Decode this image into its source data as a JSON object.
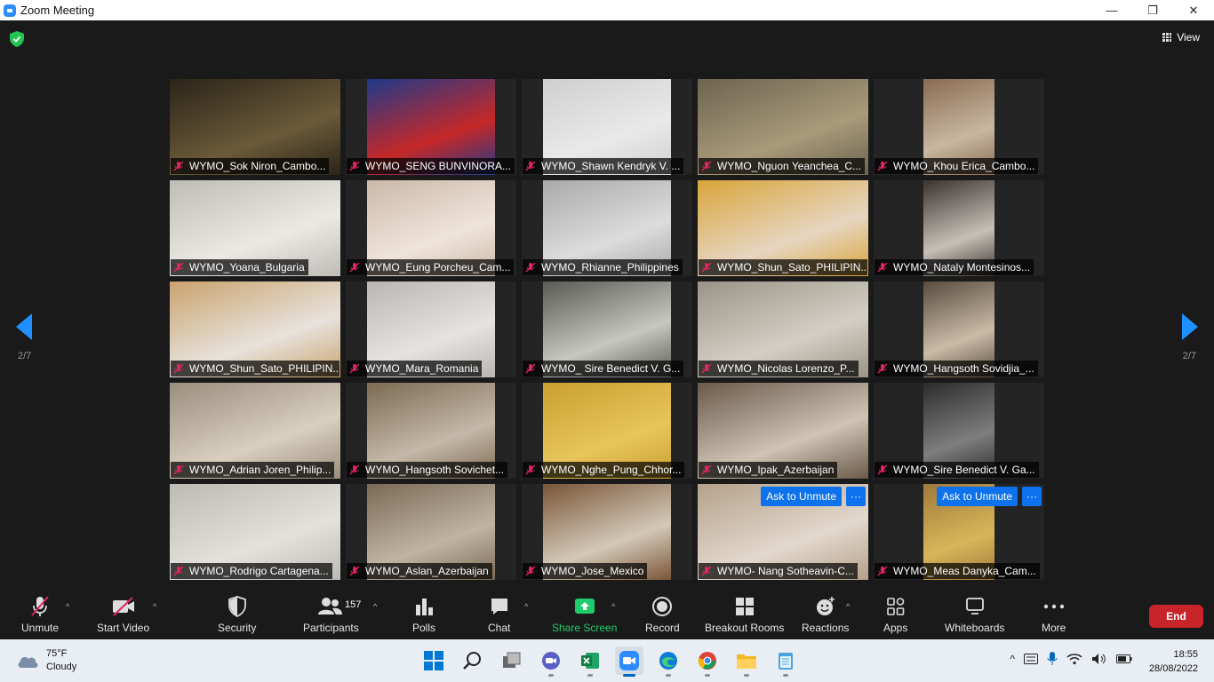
{
  "window": {
    "title": "Zoom Meeting",
    "minimize": "—",
    "restore": "❐",
    "close": "✕"
  },
  "view": {
    "label": "View"
  },
  "pagination": {
    "left": "2/7",
    "right": "2/7"
  },
  "tiles": [
    {
      "name": "WYMO_Sok Niron_Cambo...",
      "bg": "#2b2418",
      "bg2": "#6b5a3a"
    },
    {
      "name": "WYMO_SENG BUNVINORA...",
      "bg": "#1f3a8a",
      "bg2": "#c62828"
    },
    {
      "name": "WYMO_Shawn Kendryk V. ...",
      "bg": "#cfcfcf",
      "bg2": "#e9e9e9"
    },
    {
      "name": "WYMO_Nguon Yeanchea_C...",
      "bg": "#6d6450",
      "bg2": "#a89a7a"
    },
    {
      "name": "WYMO_Khou Erica_Cambo...",
      "bg": "#8a6a52",
      "bg2": "#c8b7a0"
    },
    {
      "name": "WYMO_Yoana_Bulgaria",
      "bg": "#bfbcb7",
      "bg2": "#ece9e4"
    },
    {
      "name": "WYMO_Eung Porcheu_Cam...",
      "bg": "#cbb8a8",
      "bg2": "#efe4da"
    },
    {
      "name": "WYMO_Rhianne_Philippines",
      "bg": "#a9a9a9",
      "bg2": "#dcdcdc"
    },
    {
      "name": "WYMO_Shun_Sato_PHILIPIN...",
      "bg": "#d9a53a",
      "bg2": "#e6d5c0"
    },
    {
      "name": "WYMO_Nataly Montesinos...",
      "bg": "#3b332d",
      "bg2": "#c7c0b9"
    },
    {
      "name": "WYMO_Shun_Sato_PHILIPIN...",
      "bg": "#caa36d",
      "bg2": "#e7e2dc"
    },
    {
      "name": "WYMO_Mara_Romania",
      "bg": "#b9b6b2",
      "bg2": "#e5e3e0"
    },
    {
      "name": "WYMO_ Sire Benedict V. G...",
      "bg": "#5a5a55",
      "bg2": "#c7c7c0"
    },
    {
      "name": "WYMO_Nicolas Lorenzo_P...",
      "bg": "#9a9488",
      "bg2": "#d4cfc4"
    },
    {
      "name": "WYMO_Hangsoth Sovidjia_...",
      "bg": "#5a4c3e",
      "bg2": "#c9bba6"
    },
    {
      "name": "WYMO_Adrian Joren_Philip...",
      "bg": "#9a8e7d",
      "bg2": "#d9cfbf"
    },
    {
      "name": "WYMO_Hangsoth Sovichet...",
      "bg": "#7c6a52",
      "bg2": "#c4b8a8"
    },
    {
      "name": "WYMO_Nghe_Pung_Chhor...",
      "bg": "#c9a030",
      "bg2": "#e8c45a"
    },
    {
      "name": "WYMO_Ipak_Azerbaijan",
      "bg": "#6a5a4a",
      "bg2": "#cfc3b4"
    },
    {
      "name": "WYMO_Sire Benedict V. Ga...",
      "bg": "#2c2c2c",
      "bg2": "#7e7e7e"
    },
    {
      "name": "WYMO_Rodrigo Cartagena...",
      "bg": "#bdbab5",
      "bg2": "#e4e1dc"
    },
    {
      "name": "WYMO_Aslan_Azerbaijan",
      "bg": "#7b6a55",
      "bg2": "#bfb4a3"
    },
    {
      "name": "WYMO_Jose_Mexico",
      "bg": "#7a5638",
      "bg2": "#d3c8b8"
    },
    {
      "name": "WYMO- Nang Sotheavin-C...",
      "bg": "#b5a18a",
      "bg2": "#e2d8cc",
      "ask": "Ask to Unmute",
      "more": "···"
    },
    {
      "name": "WYMO_Meas Danyka_Cam...",
      "bg": "#a07a3a",
      "bg2": "#d8b55a",
      "ask": "Ask to Unmute",
      "more": "···"
    }
  ],
  "toolbar": {
    "unmute": "Unmute",
    "start_video": "Start Video",
    "security": "Security",
    "participants": "Participants",
    "participants_count": "157",
    "polls": "Polls",
    "chat": "Chat",
    "share_screen": "Share Screen",
    "record": "Record",
    "breakout_rooms": "Breakout Rooms",
    "reactions": "Reactions",
    "apps": "Apps",
    "whiteboards": "Whiteboards",
    "more": "More",
    "end": "End",
    "caret": "^"
  },
  "taskbar": {
    "weather_temp": "75°F",
    "weather_desc": "Cloudy",
    "time": "18:55",
    "date": "28/08/2022",
    "tray_up": "^"
  },
  "colors": {
    "accent": "#0e72ed",
    "share_green": "#1fcc6b",
    "end_red": "#c8242a",
    "mic_red": "#e0245e"
  }
}
